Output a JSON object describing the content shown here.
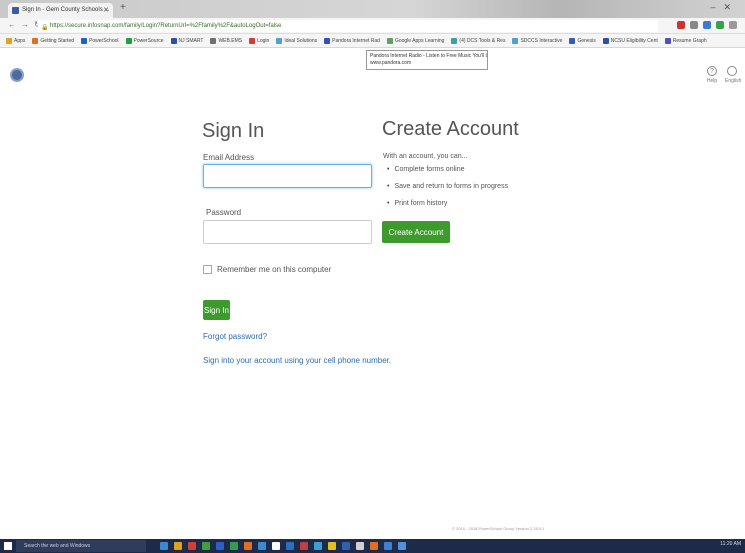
{
  "browser": {
    "tab_title": "Sign In - Gem County Schools ...",
    "url": "https://secure.infosnap.com/family/Login?ReturnUrl=%2Ffamily%2F&autoLogOut=false",
    "bookmarks": [
      {
        "label": "Apps",
        "color": "#e0a020"
      },
      {
        "label": "Getting Started",
        "color": "#e07020"
      },
      {
        "label": "PowerSchool",
        "color": "#2060c0"
      },
      {
        "label": "PowerSource",
        "color": "#20a040"
      },
      {
        "label": "NJ SMART",
        "color": "#3050a0"
      },
      {
        "label": "WEB.EMS",
        "color": "#707070"
      },
      {
        "label": "Login",
        "color": "#d04030"
      },
      {
        "label": "Ideal Solutions",
        "color": "#50a0d0"
      },
      {
        "label": "Pandora Internet Rad",
        "color": "#3050c0"
      },
      {
        "label": "Google Apps Learning",
        "color": "#60a060"
      },
      {
        "label": "(4) DCS Tools & Res",
        "color": "#40a0a0"
      },
      {
        "label": "SDCCS Interactive",
        "color": "#50a0d0"
      },
      {
        "label": "Genesis",
        "color": "#3060b0"
      },
      {
        "label": "NCSU Eligibility Cent",
        "color": "#3050a0"
      },
      {
        "label": "Resume Graph",
        "color": "#5050c0"
      }
    ],
    "tooltip_line1": "Pandora Internet Radio - Listen to Free Music You'll Love",
    "tooltip_line2": "www.pandora.com"
  },
  "header": {
    "help_label": "Help",
    "language_label": "English"
  },
  "signin": {
    "title": "Sign In",
    "email_label": "Email Address",
    "email_value": "",
    "password_label": "Password",
    "password_value": "",
    "remember_label": "Remember me on this computer",
    "signin_button": "Sign In",
    "forgot_link": "Forgot password?",
    "phone_link": "Sign into your account using your cell phone number."
  },
  "create": {
    "title": "Create Account",
    "intro": "With an account, you can...",
    "benefits": [
      "Complete forms online",
      "Save and return to forms in progress",
      "Print form history"
    ],
    "button": "Create Account"
  },
  "footer": {
    "text": "© 2010 - 2018 PowerSchool Group   Version 2.28.0.1"
  },
  "taskbar": {
    "search_placeholder": "Search the web and Windows",
    "time": "11:20 AM"
  },
  "colors": {
    "accent_green": "#3d9a2c",
    "link_blue": "#2a6db0"
  }
}
